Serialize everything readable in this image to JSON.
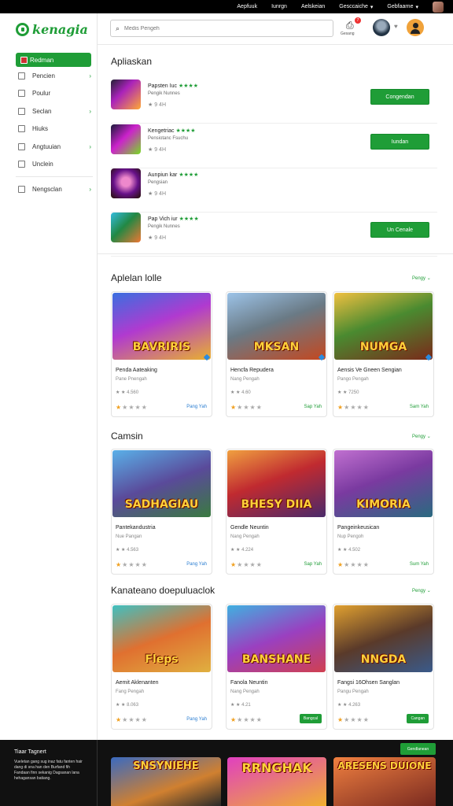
{
  "top_links": [
    "Aepfuuk",
    "Iunrgn",
    "Aelskeian",
    "Gesccaiche",
    "Gebfaarne"
  ],
  "brand": {
    "name": "kenagia",
    "color": "#1f9d37"
  },
  "search": {
    "placeholder": "Medis Pengeh",
    "icon": "search-icon"
  },
  "header": {
    "notif_count": "7",
    "notif_label": "Gesang"
  },
  "sidebar": {
    "items": [
      {
        "label": "Redman",
        "icon": "home-icon",
        "active": true
      },
      {
        "label": "Pencien",
        "icon": "grid-icon",
        "chevron": true
      },
      {
        "label": "Poulur",
        "icon": "doc-icon"
      },
      {
        "label": "Seclan",
        "icon": "folder-icon",
        "chevron": true
      },
      {
        "label": "Hiuks",
        "icon": "note-icon"
      },
      {
        "label": "Angtuuian",
        "icon": "tag-icon",
        "chevron": true
      },
      {
        "label": "Unclein",
        "icon": "list-icon"
      }
    ],
    "secondary": [
      {
        "label": "Nengsclan",
        "icon": "box-icon",
        "chevron": true
      }
    ]
  },
  "apps_section": {
    "title": "Apliaskan",
    "apps": [
      {
        "name": "Papsten Iuc",
        "stars": "★★★★",
        "sub": "Pengik Nunnes",
        "meta": "★ 9 4H",
        "button": "Congendan"
      },
      {
        "name": "Kengetriac",
        "stars": "★★★★",
        "sub": "Pensiotanc Fsuchu",
        "meta": "★ 9 4H",
        "button": "Iundan"
      },
      {
        "name": "Aunpiun kar",
        "stars": "★★★★",
        "sub": "Pengsian",
        "meta": "★ 9 4H",
        "button": ""
      },
      {
        "name": "Pap Vich iur",
        "stars": "★★★★",
        "sub": "Pengik Nunnes",
        "meta": "★ 9 4H",
        "button": "Un Cenale"
      }
    ]
  },
  "categories": [
    {
      "title": "Aplelan lolle",
      "more": "Pengy",
      "cards": [
        {
          "art": "BAVRIRIS",
          "title": "Penda Aateaking",
          "sub": "Pane Pnengah",
          "meta": "★ ★ 4.560",
          "stars": 1,
          "link": "Pang Yah",
          "link_color": "blue"
        },
        {
          "art": "MKSAN",
          "title": "Hencfa Repudera",
          "sub": "Nang Pengah",
          "meta": "★ ★ 4.60",
          "stars": 1,
          "link": "Sap Yah",
          "link_color": "green"
        },
        {
          "art": "NUMGA",
          "title": "Aensis Ve Gneen Sengian",
          "sub": "Pango Pengah",
          "meta": "★ ★ 7250",
          "stars": 1,
          "link": "Sam Yah",
          "link_color": "green"
        }
      ]
    },
    {
      "title": "Camsin",
      "more": "Pengy",
      "cards": [
        {
          "art": "SADHAGIAU",
          "title": "Pantekandustria",
          "sub": "Nue Pangan",
          "meta": "★ ★ 4.563",
          "stars": 1,
          "link": "Pang Yah",
          "link_color": "blue"
        },
        {
          "art": "BHESY DIIA",
          "title": "Gendle Neuntin",
          "sub": "Nang Pengah",
          "meta": "★ ★ 4.224",
          "stars": 1,
          "link": "Sap Yah",
          "link_color": "green"
        },
        {
          "art": "KIMORIA",
          "title": "Pangeinkeusican",
          "sub": "Nup Pengoh",
          "meta": "★ ★ 4.502",
          "stars": 1,
          "link": "Sum Yah",
          "link_color": "green"
        }
      ]
    },
    {
      "title": "Kanateano doepuluaclok",
      "more": "Pengy",
      "cards": [
        {
          "art": "Fleps",
          "title": "Aemit Aklenanten",
          "sub": "Fang Pengah",
          "meta": "★ ★ 8.063",
          "stars": 1,
          "link": "Pang Yah",
          "link_color": "blue"
        },
        {
          "art": "BANSHANE",
          "title": "Fanola Neuntin",
          "sub": "Nang Pengah",
          "meta": "★ ★ 4.21",
          "stars": 1,
          "button": "Bangcal"
        },
        {
          "art": "NNGDA",
          "title": "Fangsi 16Ohsen Sanglan",
          "sub": "Pangu Pengah",
          "meta": "★ ★ 4.263",
          "stars": 1,
          "button": "Cangan"
        }
      ]
    }
  ],
  "footer": {
    "title": "Tiaar Tagnert",
    "text": "Vueletan gang sug inaz fatu fanten hair dang di sna han den Burfand fih Fandaan finn sekanig Dagsanan lana hehagansan batiang.",
    "button": "Gendlanean",
    "arts": [
      "SNSYNIEHE",
      "RRNGHAK",
      "ARESENS DUIONE"
    ]
  }
}
